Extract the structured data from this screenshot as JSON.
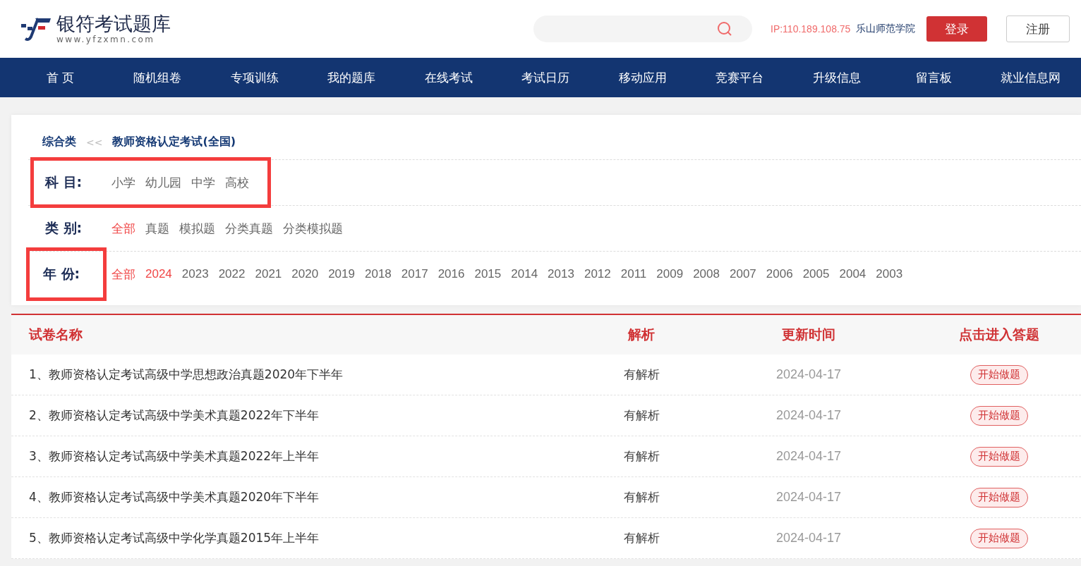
{
  "header": {
    "logo_title": "银符考试题库",
    "logo_url": "www.yfzxmn.com",
    "ip": "IP:110.189.108.75",
    "institution": "乐山师范学院",
    "login": "登录",
    "register": "注册"
  },
  "nav": [
    "首 页",
    "随机组卷",
    "专项训练",
    "我的题库",
    "在线考试",
    "考试日历",
    "移动应用",
    "竞赛平台",
    "升级信息",
    "留言板",
    "就业信息网"
  ],
  "breadcrumb": {
    "parent": "综合类",
    "separator": "<<",
    "current": "教师资格认定考试(全国)"
  },
  "filters": [
    {
      "label": "科 目:",
      "row_highlighted": true,
      "label_highlighted": false,
      "options": [
        {
          "text": "小学",
          "selected": false
        },
        {
          "text": "幼儿园",
          "selected": false
        },
        {
          "text": "中学",
          "selected": false
        },
        {
          "text": "高校",
          "selected": false
        }
      ]
    },
    {
      "label": "类 别:",
      "row_highlighted": false,
      "label_highlighted": false,
      "options": [
        {
          "text": "全部",
          "selected": true
        },
        {
          "text": "真题",
          "selected": false
        },
        {
          "text": "模拟题",
          "selected": false
        },
        {
          "text": "分类真题",
          "selected": false
        },
        {
          "text": "分类模拟题",
          "selected": false
        }
      ]
    },
    {
      "label": "年 份:",
      "row_highlighted": false,
      "label_highlighted": true,
      "options": [
        {
          "text": "全部",
          "selected": true
        },
        {
          "text": "2024",
          "selected": true
        },
        {
          "text": "2023",
          "selected": false
        },
        {
          "text": "2022",
          "selected": false
        },
        {
          "text": "2021",
          "selected": false
        },
        {
          "text": "2020",
          "selected": false
        },
        {
          "text": "2019",
          "selected": false
        },
        {
          "text": "2018",
          "selected": false
        },
        {
          "text": "2017",
          "selected": false
        },
        {
          "text": "2016",
          "selected": false
        },
        {
          "text": "2015",
          "selected": false
        },
        {
          "text": "2014",
          "selected": false
        },
        {
          "text": "2013",
          "selected": false
        },
        {
          "text": "2012",
          "selected": false
        },
        {
          "text": "2011",
          "selected": false
        },
        {
          "text": "2009",
          "selected": false
        },
        {
          "text": "2008",
          "selected": false
        },
        {
          "text": "2007",
          "selected": false
        },
        {
          "text": "2006",
          "selected": false
        },
        {
          "text": "2005",
          "selected": false
        },
        {
          "text": "2004",
          "selected": false
        },
        {
          "text": "2003",
          "selected": false
        }
      ]
    }
  ],
  "table": {
    "columns": [
      "试卷名称",
      "解析",
      "更新时间",
      "点击进入答题"
    ],
    "rows": [
      {
        "name": "1、教师资格认定考试高级中学思想政治真题2020年下半年",
        "analysis": "有解析",
        "date": "2024-04-17",
        "action": "开始做题"
      },
      {
        "name": "2、教师资格认定考试高级中学美术真题2022年下半年",
        "analysis": "有解析",
        "date": "2024-04-17",
        "action": "开始做题"
      },
      {
        "name": "3、教师资格认定考试高级中学美术真题2022年上半年",
        "analysis": "有解析",
        "date": "2024-04-17",
        "action": "开始做题"
      },
      {
        "name": "4、教师资格认定考试高级中学美术真题2020年下半年",
        "analysis": "有解析",
        "date": "2024-04-17",
        "action": "开始做题"
      },
      {
        "name": "5、教师资格认定考试高级中学化学真题2015年上半年",
        "analysis": "有解析",
        "date": "2024-04-17",
        "action": "开始做题"
      }
    ]
  }
}
